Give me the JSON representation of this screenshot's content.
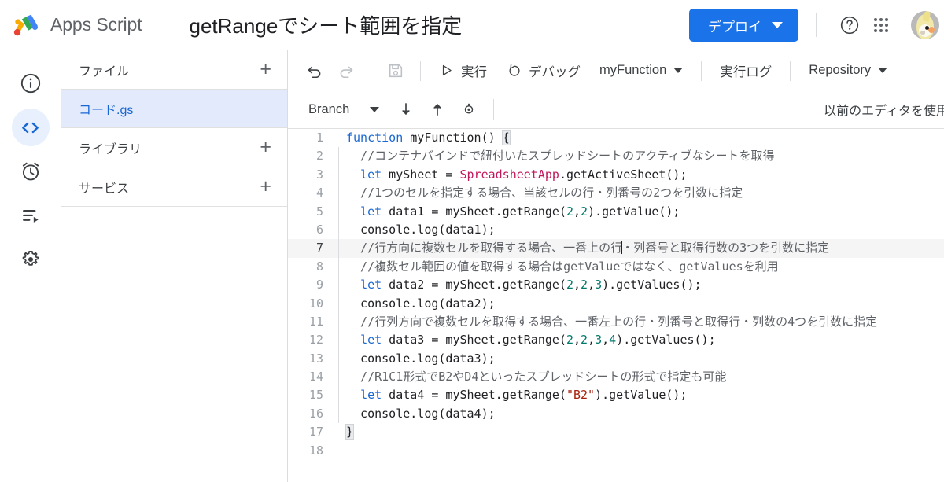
{
  "topbar": {
    "logo_icon": "apps-script-logo",
    "brand": "Apps Script",
    "doc_title": "getRangeでシート範囲を指定",
    "deploy_label": "デプロイ",
    "deploy_color": "#1a73e8",
    "help_icon": "help-circle-icon",
    "apps_icon": "apps-grid-icon",
    "avatar_icon": "user-avatar"
  },
  "rail": {
    "items": [
      {
        "icon": "info-circle-icon",
        "name": "overview",
        "active": false
      },
      {
        "icon": "code-brackets-icon",
        "name": "editor",
        "active": true
      },
      {
        "icon": "alarm-clock-icon",
        "name": "triggers",
        "active": false
      },
      {
        "icon": "executions-list-icon",
        "name": "executions",
        "active": false
      },
      {
        "icon": "gear-icon",
        "name": "settings",
        "active": false
      }
    ]
  },
  "files": {
    "sections": [
      {
        "label": "ファイル",
        "add_icon": "plus-icon"
      },
      {
        "label": "ライブラリ",
        "add_icon": "plus-icon"
      },
      {
        "label": "サービス",
        "add_icon": "plus-icon"
      }
    ],
    "file_label": "コード.gs"
  },
  "toolbar": {
    "undo_icon": "undo-icon",
    "redo_icon": "redo-icon",
    "save_icon": "save-icon",
    "run_icon": "play-icon",
    "run_label": "実行",
    "debug_icon": "debug-icon",
    "debug_label": "デバッグ",
    "function_select": "myFunction",
    "exec_log_label": "実行ログ",
    "repository_label": "Repository"
  },
  "toolbar2": {
    "branch_label": "Branch",
    "pull_icon": "arrow-down-icon",
    "push_icon": "arrow-up-icon",
    "sync_icon": "sync-gear-icon",
    "legacy_editor_label": "以前のエディタを使用"
  },
  "code": {
    "lines": [
      {
        "n": "1",
        "fold": false,
        "active": false,
        "tokens": [
          {
            "t": "function ",
            "c": "kw"
          },
          {
            "t": "myFunction() ",
            "c": ""
          },
          {
            "t": "{",
            "c": "brace-hl"
          }
        ]
      },
      {
        "n": "2",
        "fold": true,
        "active": false,
        "tokens": [
          {
            "t": "  //コンテナバインドで紐付いたスプレッドシートのアクティブなシートを取得",
            "c": "cmt"
          }
        ]
      },
      {
        "n": "3",
        "fold": true,
        "active": false,
        "tokens": [
          {
            "t": "  ",
            "c": ""
          },
          {
            "t": "let",
            "c": "kw"
          },
          {
            "t": " mySheet = ",
            "c": ""
          },
          {
            "t": "SpreadsheetApp",
            "c": "cls"
          },
          {
            "t": ".getActiveSheet();",
            "c": ""
          }
        ]
      },
      {
        "n": "4",
        "fold": true,
        "active": false,
        "tokens": [
          {
            "t": "  //1つのセルを指定する場合、当該セルの行・列番号の2つを引数に指定",
            "c": "cmt"
          }
        ]
      },
      {
        "n": "5",
        "fold": true,
        "active": false,
        "tokens": [
          {
            "t": "  ",
            "c": ""
          },
          {
            "t": "let",
            "c": "kw"
          },
          {
            "t": " data1 = mySheet.getRange(",
            "c": ""
          },
          {
            "t": "2",
            "c": "num"
          },
          {
            "t": ",",
            "c": ""
          },
          {
            "t": "2",
            "c": "num"
          },
          {
            "t": ").getValue();",
            "c": ""
          }
        ]
      },
      {
        "n": "6",
        "fold": true,
        "active": false,
        "tokens": [
          {
            "t": "  console.log(data1);",
            "c": ""
          }
        ]
      },
      {
        "n": "7",
        "fold": true,
        "active": true,
        "tokens": [
          {
            "t": "  //行方向に複数セルを取得する場合、一番上の行",
            "c": "cmt"
          },
          {
            "t": "|CURSOR|",
            "c": "cursor"
          },
          {
            "t": "・列番号と取得行数の3つを引数に指定",
            "c": "cmt"
          }
        ]
      },
      {
        "n": "8",
        "fold": true,
        "active": false,
        "tokens": [
          {
            "t": "  //複数セル範囲の値を取得する場合はgetValueではなく、getValuesを利用",
            "c": "cmt"
          }
        ]
      },
      {
        "n": "9",
        "fold": true,
        "active": false,
        "tokens": [
          {
            "t": "  ",
            "c": ""
          },
          {
            "t": "let",
            "c": "kw"
          },
          {
            "t": " data2 = mySheet.getRange(",
            "c": ""
          },
          {
            "t": "2",
            "c": "num"
          },
          {
            "t": ",",
            "c": ""
          },
          {
            "t": "2",
            "c": "num"
          },
          {
            "t": ",",
            "c": ""
          },
          {
            "t": "3",
            "c": "num"
          },
          {
            "t": ").getValues();",
            "c": ""
          }
        ]
      },
      {
        "n": "10",
        "fold": true,
        "active": false,
        "tokens": [
          {
            "t": "  console.log(data2);",
            "c": ""
          }
        ]
      },
      {
        "n": "11",
        "fold": true,
        "active": false,
        "tokens": [
          {
            "t": "  //行列方向で複数セルを取得する場合、一番左上の行・列番号と取得行・列数の4つを引数に指定",
            "c": "cmt"
          }
        ]
      },
      {
        "n": "12",
        "fold": true,
        "active": false,
        "tokens": [
          {
            "t": "  ",
            "c": ""
          },
          {
            "t": "let",
            "c": "kw"
          },
          {
            "t": " data3 = mySheet.getRange(",
            "c": ""
          },
          {
            "t": "2",
            "c": "num"
          },
          {
            "t": ",",
            "c": ""
          },
          {
            "t": "2",
            "c": "num"
          },
          {
            "t": ",",
            "c": ""
          },
          {
            "t": "3",
            "c": "num"
          },
          {
            "t": ",",
            "c": ""
          },
          {
            "t": "4",
            "c": "num"
          },
          {
            "t": ").getValues();",
            "c": ""
          }
        ]
      },
      {
        "n": "13",
        "fold": true,
        "active": false,
        "tokens": [
          {
            "t": "  console.log(data3);",
            "c": ""
          }
        ]
      },
      {
        "n": "14",
        "fold": true,
        "active": false,
        "tokens": [
          {
            "t": "  //R1C1形式でB2やD4といったスプレッドシートの形式で指定も可能",
            "c": "cmt"
          }
        ]
      },
      {
        "n": "15",
        "fold": true,
        "active": false,
        "tokens": [
          {
            "t": "  ",
            "c": ""
          },
          {
            "t": "let",
            "c": "kw"
          },
          {
            "t": " data4 = mySheet.getRange(",
            "c": ""
          },
          {
            "t": "\"B2\"",
            "c": "str"
          },
          {
            "t": ").getValue();",
            "c": ""
          }
        ]
      },
      {
        "n": "16",
        "fold": true,
        "active": false,
        "tokens": [
          {
            "t": "  console.log(data4);",
            "c": ""
          }
        ]
      },
      {
        "n": "17",
        "fold": false,
        "active": false,
        "tokens": [
          {
            "t": "}",
            "c": "brace-hl"
          }
        ]
      },
      {
        "n": "18",
        "fold": false,
        "active": false,
        "tokens": [
          {
            "t": "",
            "c": ""
          }
        ]
      }
    ]
  }
}
